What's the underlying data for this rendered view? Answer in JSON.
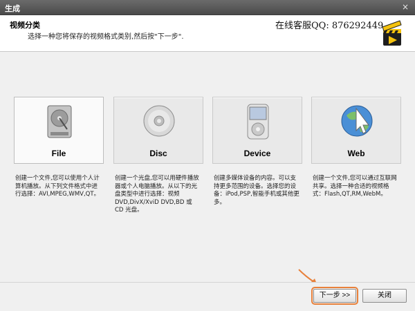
{
  "window": {
    "title": "生成",
    "close_symbol": "×"
  },
  "header": {
    "title": "视频分类",
    "subtitle": "选择一种您将保存的视频格式类别,然后按\"下一步\".",
    "support": "在线客服QQ: 876292449"
  },
  "cards": [
    {
      "label": "File",
      "icon": "hard-drive-icon",
      "description": "创建一个文件,您可以使用个人计算机播放。从下列文件格式中进行选择：AVI,MPEG,WMV,QT。"
    },
    {
      "label": "Disc",
      "icon": "disc-icon",
      "description": "创建一个光盘,您可以用硬件播放器或个人电脑播放。从以下的光盘类型中进行选择：视频 DVD,DivX/XviD DVD,BD 或 CD 光盘。"
    },
    {
      "label": "Device",
      "icon": "media-player-icon",
      "description": "创建多媒体设备的内容。可以支持更多范围的设备。选择您的设备：iPod,PSP,智能手机或其他更多。"
    },
    {
      "label": "Web",
      "icon": "globe-cursor-icon",
      "description": "创建一个文件,您可以通过互联网共享。选择一种合适的视频格式：Flash,QT,RM,WebM。"
    }
  ],
  "footer": {
    "next_label": "下一步 >>",
    "close_label": "关闭"
  },
  "colors": {
    "highlight": "#e8803a",
    "titlebar": "#555555"
  }
}
